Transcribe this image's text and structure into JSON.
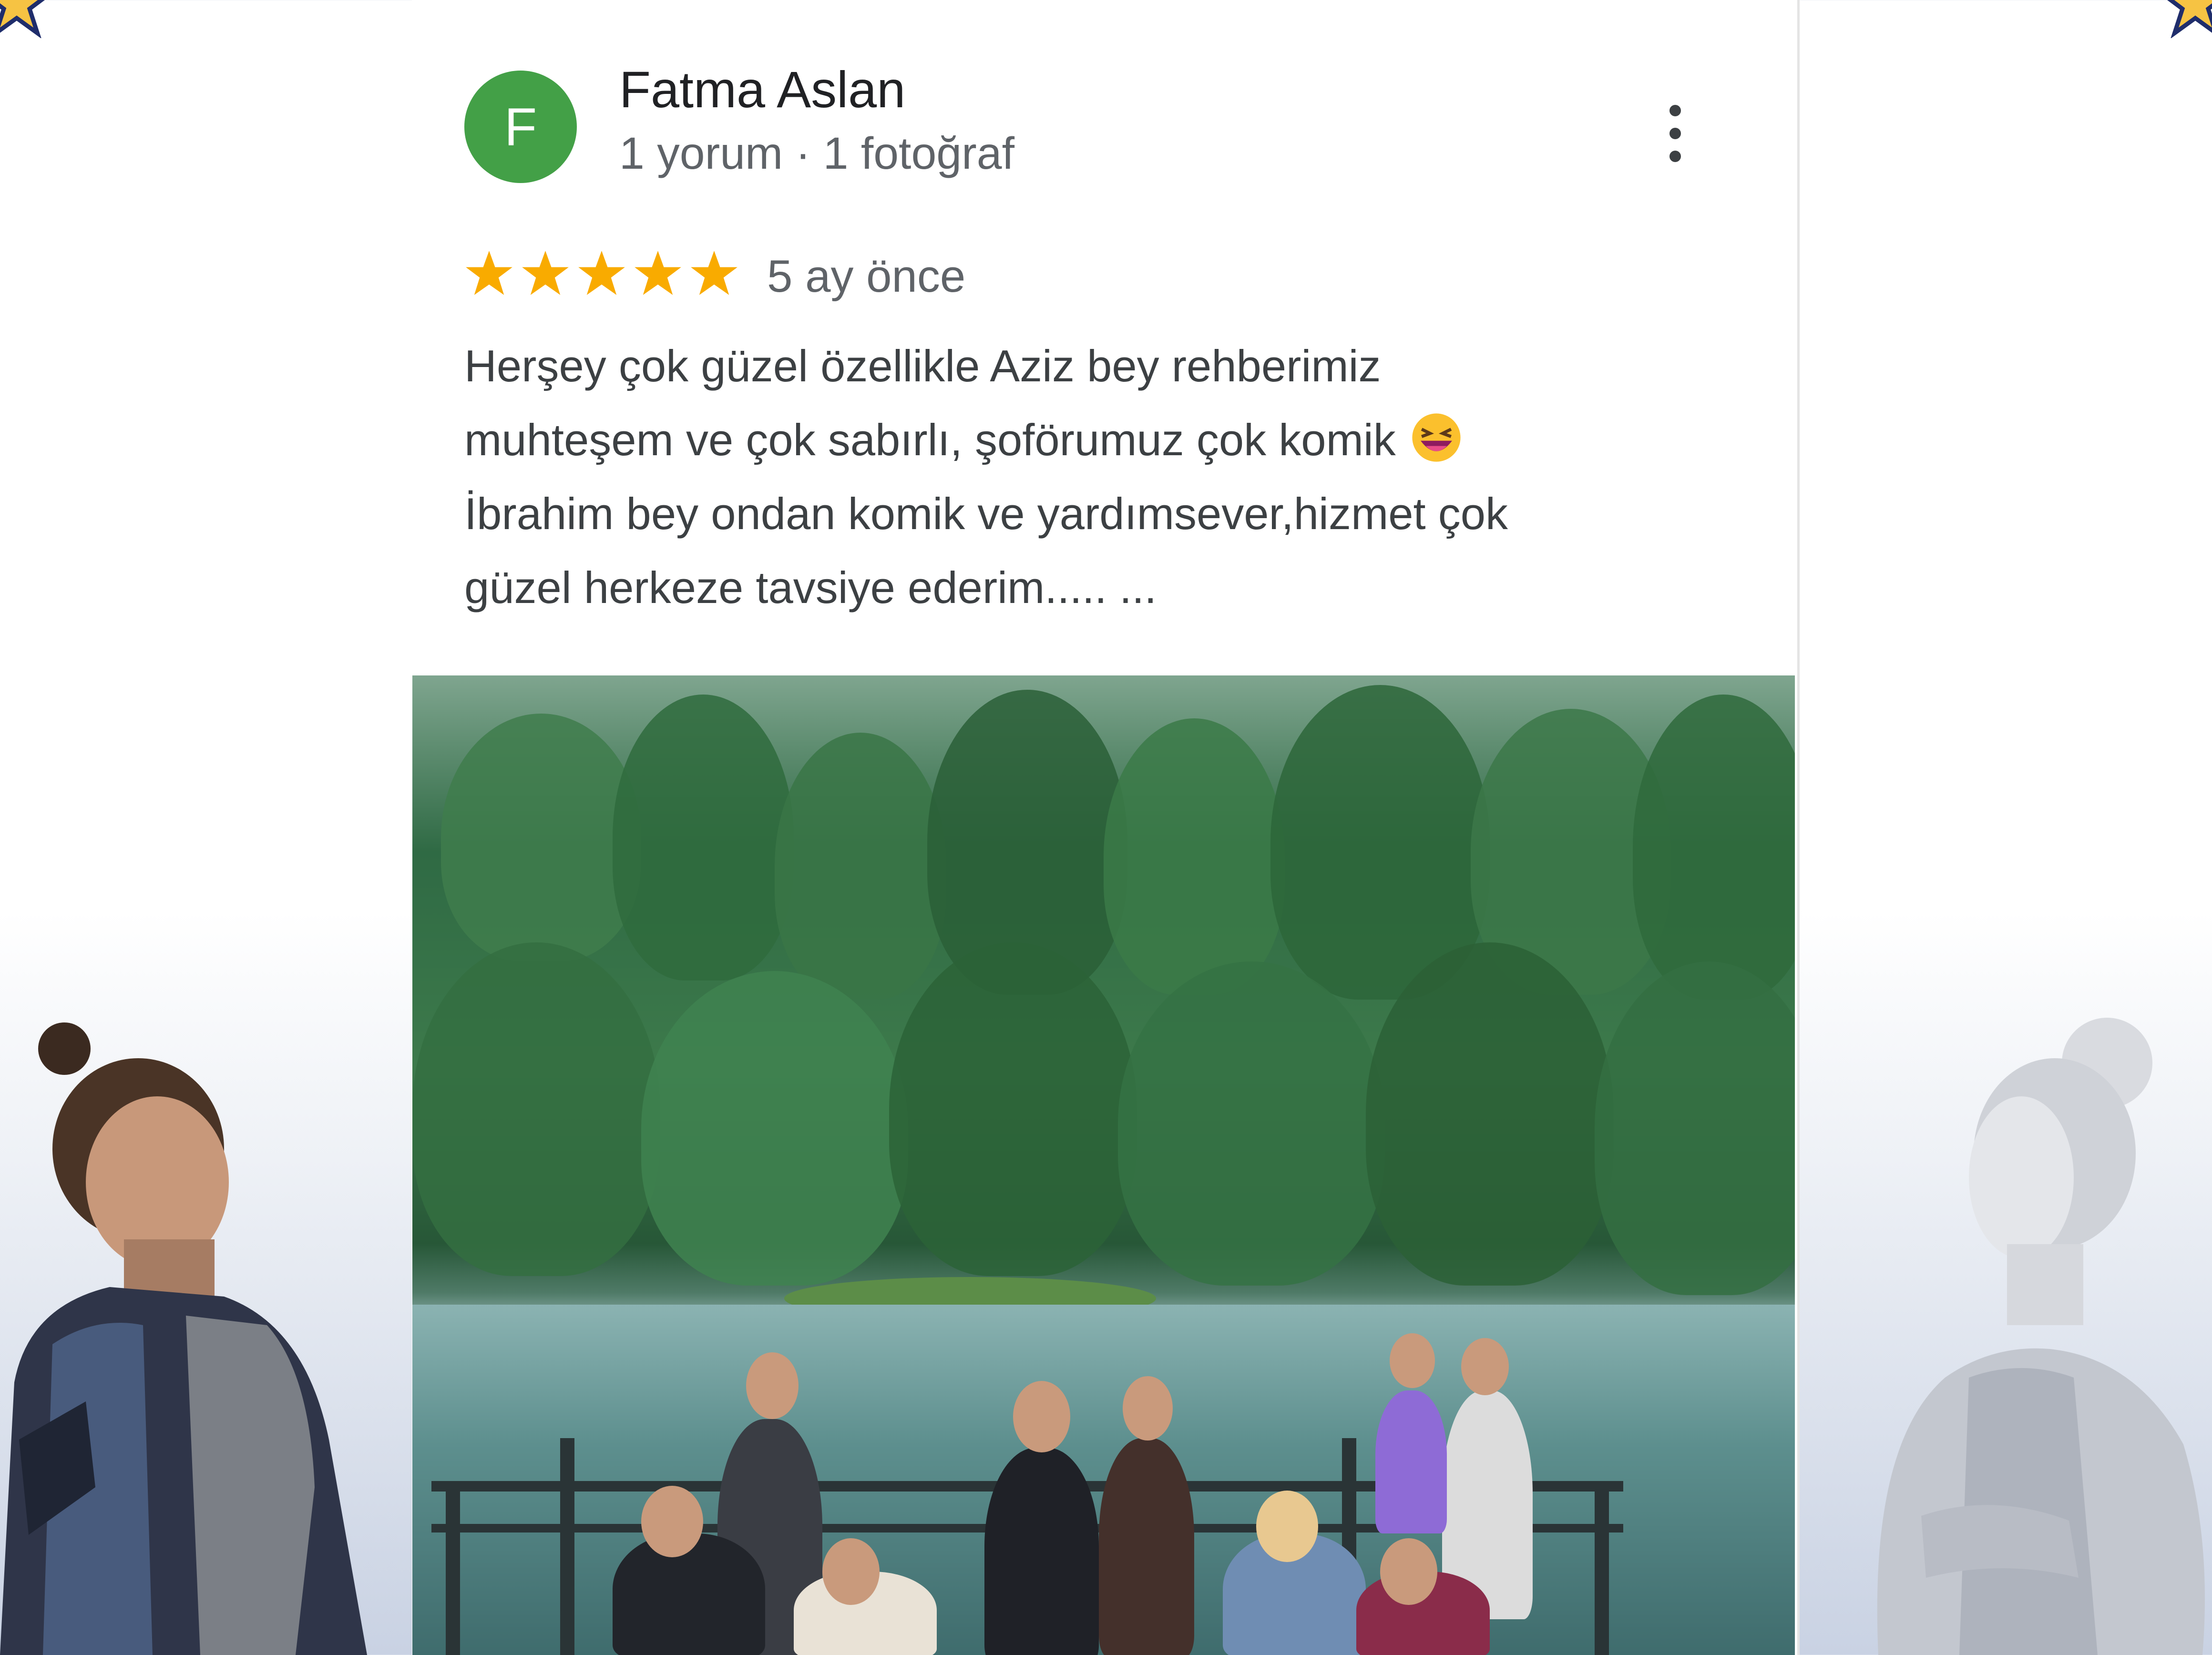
{
  "review": {
    "author_initial": "F",
    "author_name": "Fatma Aslan",
    "author_meta": "1 yorum · 1 fotoğraf",
    "rating": 5,
    "time_ago": "5 ay önce",
    "text_lines": [
      "Herşey çok güzel özellikle Aziz bey rehberimiz",
      "muhteşem ve çok sabırlı, şoförumuz çok komik",
      "İbrahim bey ondan komik ve yardımsever,hizmet çok",
      "güzel herkeze tavsiye ederim..... ..."
    ]
  },
  "colors": {
    "avatar_bg": "#43a047",
    "star": "#f9ab00",
    "name_text": "#202124",
    "meta_text": "#5f6368",
    "body_text": "#3c4043"
  },
  "icons": {
    "menu": "more-vert-icon",
    "emoji": "grinning-squinting-face-emoji",
    "star": "star-icon"
  }
}
